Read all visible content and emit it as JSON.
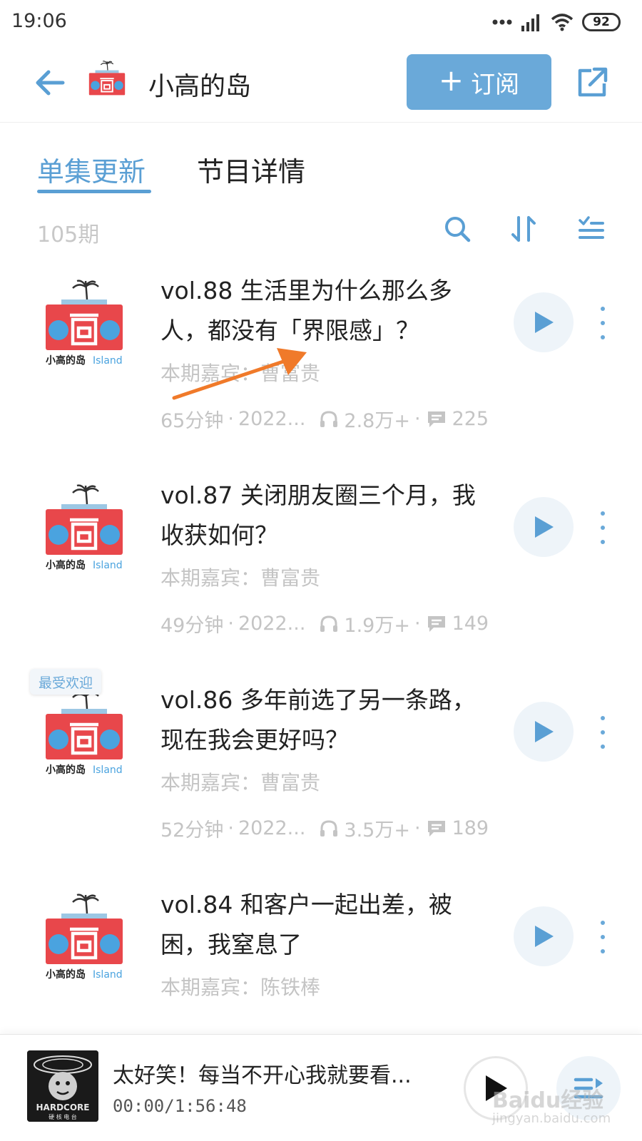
{
  "status_bar": {
    "time": "19:06",
    "battery": "92"
  },
  "header": {
    "title": "小高的岛",
    "subscribe_label": "订阅"
  },
  "tabs": [
    {
      "label": "单集更新"
    },
    {
      "label": "节目详情"
    }
  ],
  "toolbar": {
    "episode_count": "105期"
  },
  "episodes": [
    {
      "title": "vol.88 生活里为什么那么多人，都没有「界限感」？",
      "guest": "本期嘉宾：曹富贵",
      "duration": "65分钟",
      "date": "2022...",
      "plays": "2.8万+",
      "comments": "225",
      "badge": ""
    },
    {
      "title": "vol.87 关闭朋友圈三个月，我收获如何？",
      "guest": "本期嘉宾：曹富贵",
      "duration": "49分钟",
      "date": "2022...",
      "plays": "1.9万+",
      "comments": "149",
      "badge": ""
    },
    {
      "title": "vol.86 多年前选了另一条路，现在我会更好吗？",
      "guest": "本期嘉宾：曹富贵",
      "duration": "52分钟",
      "date": "2022...",
      "plays": "3.5万+",
      "comments": "189",
      "badge": "最受欢迎"
    },
    {
      "title": "vol.84 和客户一起出差，被困，我窒息了",
      "guest": "本期嘉宾：陈铁棒",
      "duration": "",
      "date": "",
      "plays": "",
      "comments": "",
      "badge": ""
    }
  ],
  "cover": {
    "brand_text": "小高的岛",
    "brand_suffix": "Island",
    "glyph": "高"
  },
  "player": {
    "title": "太好笑！每当不开心我就要看...",
    "time": "00:00/1:56:48",
    "cover_text": "HARDCORE",
    "cover_sub": "硬 核 电 台"
  },
  "watermark": {
    "main": "Baidu经验",
    "sub": "jingyan.baidu.com"
  },
  "colors": {
    "accent": "#5a9fd4",
    "subscribe_bg": "#6aa9d9",
    "cover_red": "#e8474b",
    "cover_blue": "#4aa3df",
    "arrow": "#f07a2a"
  }
}
